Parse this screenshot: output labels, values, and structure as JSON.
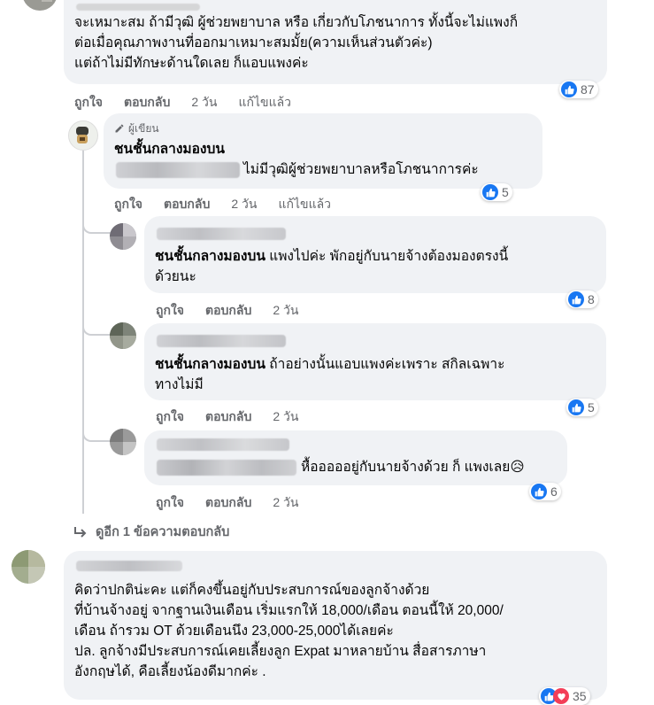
{
  "comments": {
    "c1": {
      "lines": [
        "จะเหมาะสม ถ้ามีวุฒิ ผู้ช่วยพยาบาล หรือ เกี่ยวกับโภชนาการ ทั้งนี้จะไม่แพงก็",
        "ต่อเมื่อคุณภาพงานที่ออกมาเหมาะสมมั้ย(ความเห็นส่วนตัวค่ะ)",
        "แต่ถ้าไม่มีทักษะด้านใดเลย ก็แอบแพงค่ะ"
      ],
      "like": "ถูกใจ",
      "reply": "ตอบกลับ",
      "time": "2 วัน",
      "edited": "แก้ไขแล้ว",
      "reaction_count": "87"
    },
    "c2": {
      "badge": "ผู้เขียน",
      "name": "ชนชั้นกลางมองบน",
      "text": "ไม่มีวุฒิผู้ช่วยพยาบาลหรือโภชนาการค่ะ",
      "like": "ถูกใจ",
      "reply": "ตอบกลับ",
      "time": "2 วัน",
      "edited": "แก้ไขแล้ว",
      "reaction_count": "5"
    },
    "c3": {
      "mention": "ชนชั้นกลางมองบน",
      "text1": " แพงไปค่ะ พักอยู่กับนายจ้างต้องมองตรงนี้",
      "text2": "ด้วยนะ",
      "like": "ถูกใจ",
      "reply": "ตอบกลับ",
      "time": "2 วัน",
      "reaction_count": "8"
    },
    "c4": {
      "mention": "ชนชั้นกลางมองบน",
      "text1": " ถ้าอย่างนั้นแอบแพงค่ะเพราะ สกิลเฉพาะ",
      "text2": "ทางไม่มี",
      "like": "ถูกใจ",
      "reply": "ตอบกลับ",
      "time": "2 วัน",
      "reaction_count": "5"
    },
    "c5": {
      "text": "หื้อออออยู่กับนายจ้างด้วย ก็ แพงเลย",
      "emoji": "😥",
      "like": "ถูกใจ",
      "reply": "ตอบกลับ",
      "time": "2 วัน",
      "reaction_count": "6"
    },
    "more_replies": "ดูอีก 1 ข้อความตอบกลับ",
    "c6": {
      "lines": [
        "คิดว่าปกติน่ะคะ แต่ก็คงขึ้นอยู่กับประสบการณ์ของลูกจ้างด้วย",
        "ที่บ้านจ้างอยู่ จากฐานเงินเดือน เริ่มแรกให้ 18,000/เดือน ตอนนี้ให้ 20,000/",
        "เดือน ถ้ารวม OT ด้วยเดือนนึง 23,000-25,000ได้เลยค่ะ",
        "ปล. ลูกจ้างมีประสบการณ์เคยเลี้ยงลูก Expat มาหลายบ้าน สื่อสารภาษา",
        "อังกฤษได้, คือเลี้ยงน้องดีมากค่ะ ."
      ],
      "reaction_count": "35"
    }
  },
  "colors": {
    "bubble": "#f0f2f5",
    "meta": "#65676b",
    "like_blue": "#1877f2",
    "heart_red": "#f33e58"
  },
  "icons": [
    "thumbs-up-icon",
    "pencil-icon",
    "reply-arrow-icon",
    "heart-icon"
  ]
}
